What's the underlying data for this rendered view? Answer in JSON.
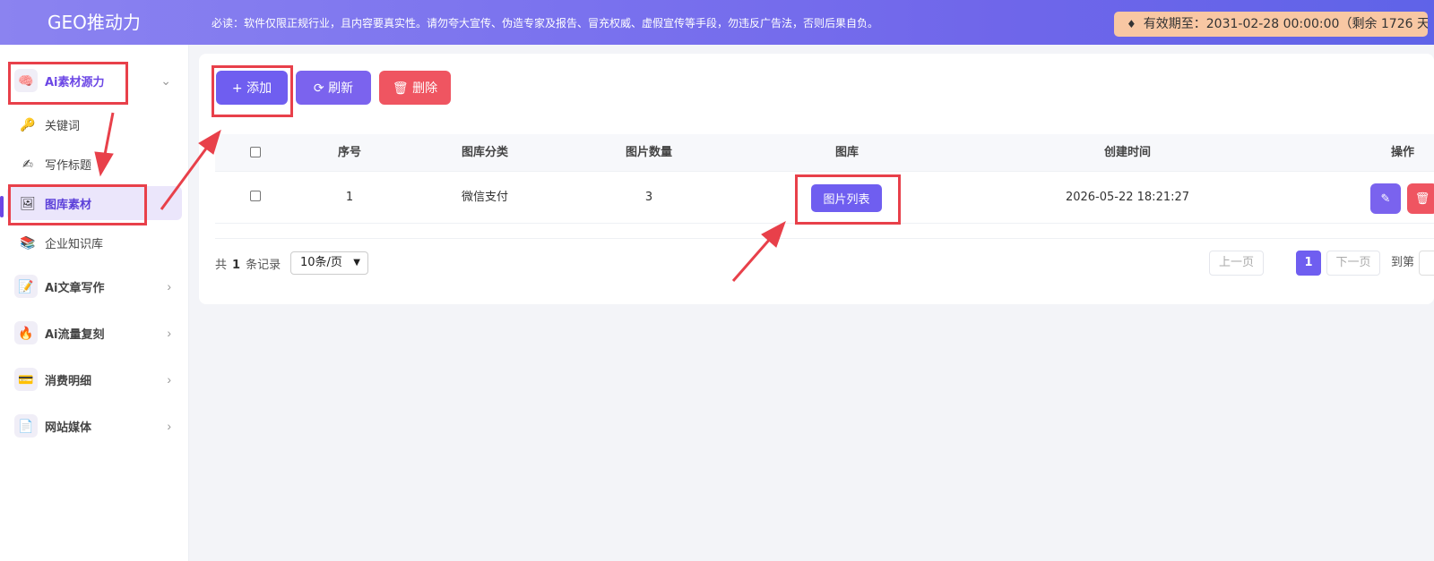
{
  "header": {
    "logo": "GEO推动力",
    "notice": "必读：软件仅限正规行业，且内容要真实性。请勿夸大宣传、伪造专家及报告、冒充权威、虚假宣传等手段，勿违反广告法，否则后果自负。",
    "expire_label": "有效期至：2031-02-28 00:00:00（剩余 1726 天）",
    "expire_icon": "diamond-icon"
  },
  "sidebar": {
    "groups": [
      {
        "label": "Ai素材源力",
        "icon": "brain-icon",
        "expanded": true
      },
      {
        "label": "Ai文章写作",
        "icon": "pencil-icon"
      },
      {
        "label": "Ai流量复刻",
        "icon": "fire-icon"
      },
      {
        "label": "消费明细",
        "icon": "card-icon"
      },
      {
        "label": "网站媒体",
        "icon": "document-icon"
      }
    ],
    "sub_items": [
      {
        "label": "关键词",
        "icon": "key-icon"
      },
      {
        "label": "写作标题",
        "icon": "writing-hand-icon"
      },
      {
        "label": "图库素材",
        "icon": "picture-icon",
        "active": true
      },
      {
        "label": "企业知识库",
        "icon": "books-icon"
      }
    ]
  },
  "toolbar": {
    "add_label": "+ 添加",
    "refresh_label": "⟳ 刷新",
    "delete_label": "🗑 删除"
  },
  "table": {
    "columns": [
      "序号",
      "图库分类",
      "图片数量",
      "图库",
      "创建时间",
      "操作"
    ],
    "rows": [
      {
        "index": "1",
        "category": "微信支付",
        "count": "3",
        "gallery_button": "图片列表",
        "created": "2026-05-22 18:21:27"
      }
    ]
  },
  "pagination": {
    "total_prefix": "共",
    "total_count": "1",
    "total_suffix": "条记录",
    "page_size": "10条/页",
    "prev": "上一页",
    "current": "1",
    "next": "下一页",
    "goto": "到第"
  },
  "colors": {
    "accent": "#6f5ef0",
    "danger": "#ef5561",
    "annotation": "#e8404a"
  }
}
